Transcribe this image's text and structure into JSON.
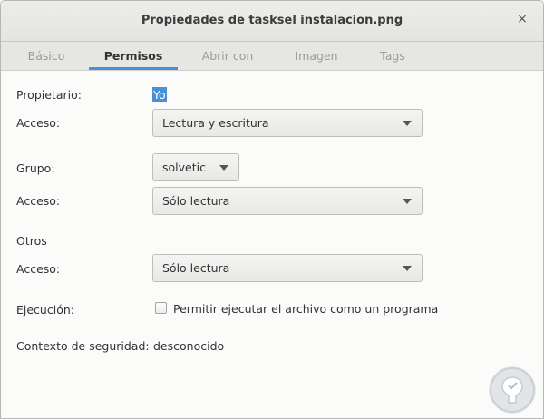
{
  "window": {
    "title": "Propiedades de tasksel instalacion.png",
    "close_glyph": "×"
  },
  "tabs": [
    {
      "label": "Básico",
      "active": false
    },
    {
      "label": "Permisos",
      "active": true
    },
    {
      "label": "Abrir con",
      "active": false
    },
    {
      "label": "Imagen",
      "active": false
    },
    {
      "label": "Tags",
      "active": false
    }
  ],
  "owner": {
    "label": "Propietario:",
    "value": "Yo"
  },
  "owner_access": {
    "label": "Acceso:",
    "value": "Lectura y escritura"
  },
  "group": {
    "label": "Grupo:",
    "value": "solvetic"
  },
  "group_access": {
    "label": "Acceso:",
    "value": "Sólo lectura"
  },
  "others": {
    "label": "Otros"
  },
  "others_access": {
    "label": "Acceso:",
    "value": "Sólo lectura"
  },
  "execution": {
    "label": "Ejecución:",
    "checkbox_label": "Permitir ejecutar el archivo como un programa",
    "checked": false
  },
  "security": {
    "label": "Contexto de seguridad:",
    "value": "desconocido"
  },
  "colors": {
    "accent": "#4a90d9"
  },
  "icons": {
    "dropdown": "chevron-down-icon",
    "watermark": "solvetic-logo"
  }
}
